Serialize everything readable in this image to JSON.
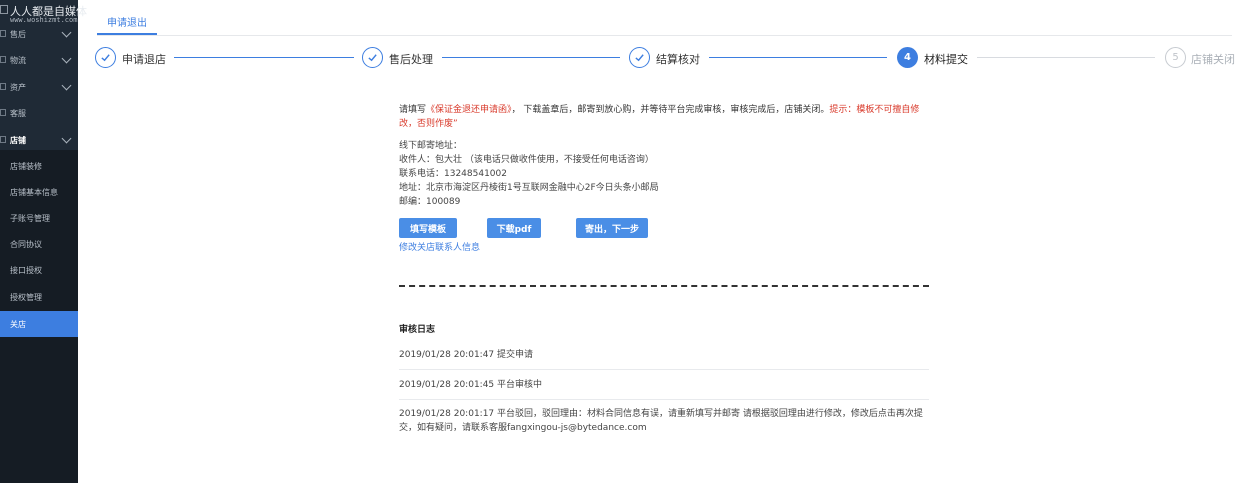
{
  "watermark": {
    "title": "人人都是自媒体",
    "url": "www.woshizmt.com"
  },
  "sidebar": {
    "items": [
      {
        "label": "售后"
      },
      {
        "label": "物流"
      },
      {
        "label": "资产"
      },
      {
        "label": "客服"
      },
      {
        "label": "店铺"
      },
      {
        "label": "店铺装修"
      },
      {
        "label": "店铺基本信息"
      },
      {
        "label": "子账号管理"
      },
      {
        "label": "合同协议"
      },
      {
        "label": "接口授权"
      },
      {
        "label": "授权管理"
      },
      {
        "label": "关店"
      }
    ]
  },
  "tab": {
    "label": "申请退出"
  },
  "steps": [
    {
      "label": "申请退店",
      "number": "1",
      "status": "done"
    },
    {
      "label": "售后处理",
      "number": "2",
      "status": "done"
    },
    {
      "label": "结算核对",
      "number": "3",
      "status": "done"
    },
    {
      "label": "材料提交",
      "number": "4",
      "status": "current"
    },
    {
      "label": "店铺关闭",
      "number": "5",
      "status": "pending"
    }
  ],
  "notice": {
    "prefix": "请填写",
    "doc_name": "《保证金退还申请函》",
    "middle": "， 下载盖章后，邮寄到放心购，并等待平台完成审核，审核完成后，店铺关闭。",
    "tip": "提示：模板不可擅自修改，否则作废”"
  },
  "address": {
    "heading": "线下邮寄地址：",
    "recipient": "收件人：包大壮 （该电话只做收件使用，不接受任何电话咨询）",
    "phone": "联系电话：13248541002",
    "addr": "地址：北京市海淀区丹棱街1号互联网金融中心2F今日头条小邮局",
    "zip": "邮编：100089"
  },
  "buttons": {
    "fill_template": "填写模板",
    "download_pdf": "下载pdf",
    "send_next": "寄出，下一步"
  },
  "link": {
    "edit_contact": "修改关店联系人信息"
  },
  "log": {
    "title": "审核日志",
    "entries": [
      {
        "text": "2019/01/28 20:01:47 提交申请"
      },
      {
        "text": "2019/01/28 20:01:45 平台审核中"
      },
      {
        "text": "2019/01/28 20:01:17 平台驳回，驳回理由：材料合同信息有误，请重新填写并邮寄 请根据驳回理由进行修改，修改后点击再次提交，如有疑问，请联系客服fangxingou-js@bytedance.com"
      }
    ]
  },
  "colors": {
    "accent": "#3d7ee0",
    "sidebar_bg": "#1f2a36",
    "warning": "#d93a2b"
  }
}
